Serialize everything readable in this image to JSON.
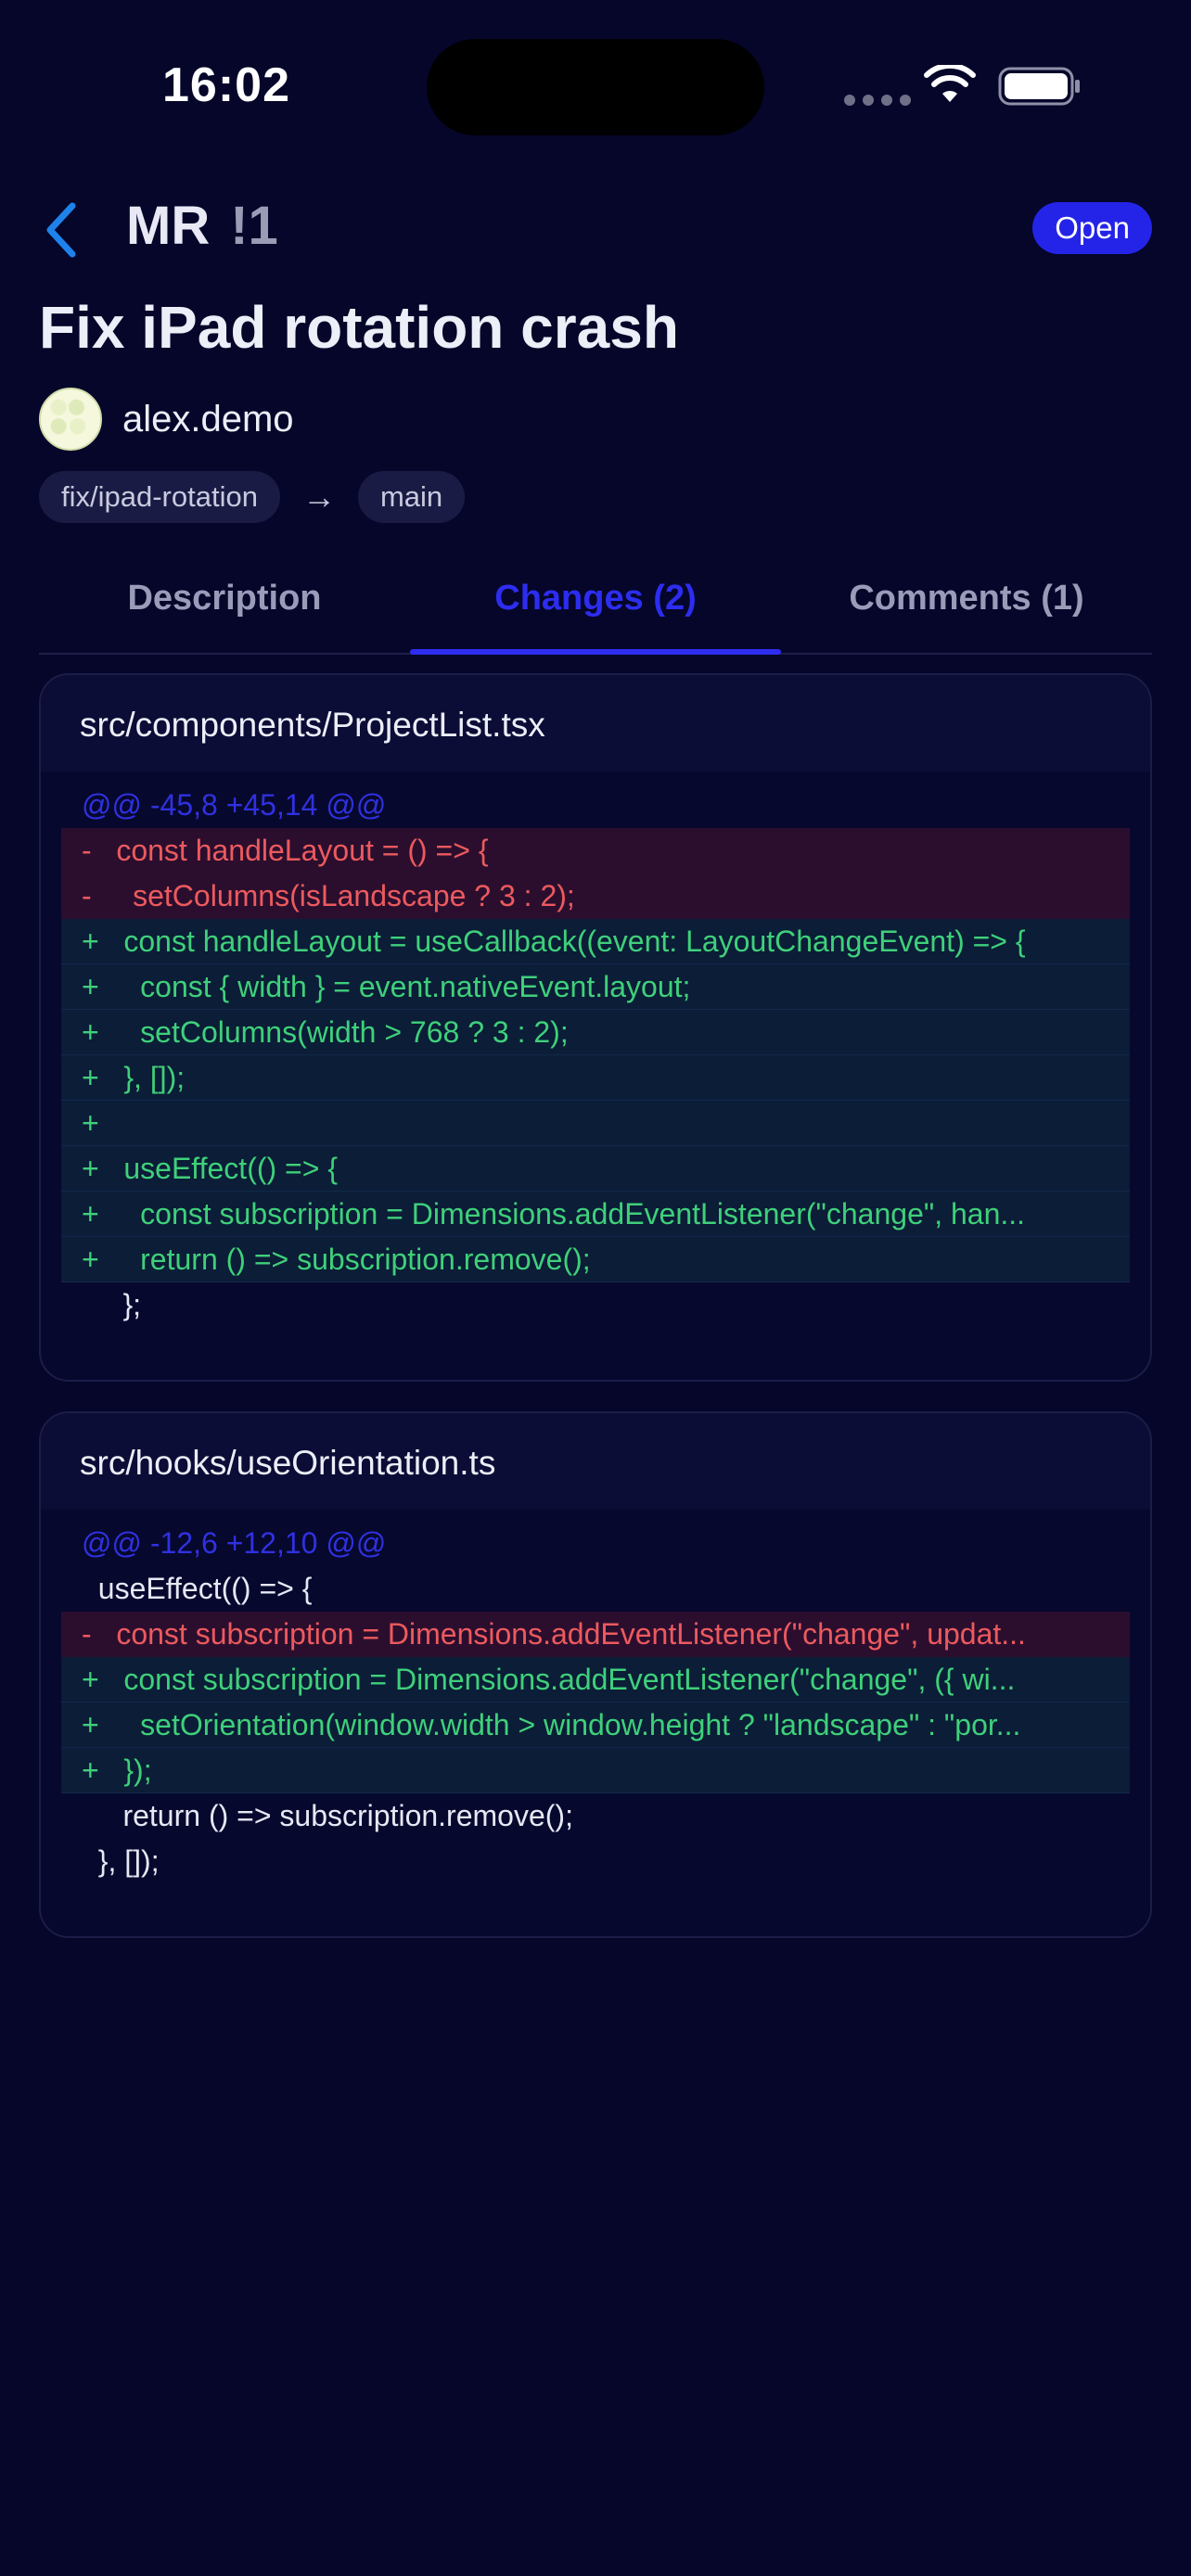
{
  "status_bar": {
    "time": "16:02"
  },
  "header": {
    "mr_prefix": "MR",
    "mr_number": "!1",
    "status": "Open"
  },
  "mr": {
    "title": "Fix iPad rotation crash",
    "author": "alex.demo",
    "source_branch": "fix/ipad-rotation",
    "arrow": "→",
    "target_branch": "main"
  },
  "tabs": [
    {
      "label": "Description",
      "active": false
    },
    {
      "label": "Changes (2)",
      "active": true
    },
    {
      "label": "Comments (1)",
      "active": false
    }
  ],
  "files": [
    {
      "path": "src/components/ProjectList.tsx",
      "lines": [
        {
          "type": "hunk",
          "text": "@@ -45,8 +45,14 @@"
        },
        {
          "type": "del",
          "text": "-   const handleLayout = () => {"
        },
        {
          "type": "del",
          "text": "-     setColumns(isLandscape ? 3 : 2);"
        },
        {
          "type": "add",
          "text": "+   const handleLayout = useCallback((event: LayoutChangeEvent) => {"
        },
        {
          "type": "add",
          "text": "+     const { width } = event.nativeEvent.layout;"
        },
        {
          "type": "add",
          "text": "+     setColumns(width > 768 ? 3 : 2);"
        },
        {
          "type": "add",
          "text": "+   }, []);"
        },
        {
          "type": "add",
          "text": "+"
        },
        {
          "type": "add",
          "text": "+   useEffect(() => {"
        },
        {
          "type": "add",
          "text": "+     const subscription = Dimensions.addEventListener(\"change\", han..."
        },
        {
          "type": "add",
          "text": "+     return () => subscription.remove();"
        },
        {
          "type": "ctx",
          "text": "     };"
        }
      ]
    },
    {
      "path": "src/hooks/useOrientation.ts",
      "lines": [
        {
          "type": "hunk",
          "text": "@@ -12,6 +12,10 @@"
        },
        {
          "type": "ctx",
          "text": "  useEffect(() => {"
        },
        {
          "type": "del",
          "text": "-   const subscription = Dimensions.addEventListener(\"change\", updat..."
        },
        {
          "type": "add",
          "text": "+   const subscription = Dimensions.addEventListener(\"change\", ({ wi..."
        },
        {
          "type": "add",
          "text": "+     setOrientation(window.width > window.height ? \"landscape\" : \"por..."
        },
        {
          "type": "add",
          "text": "+   });"
        },
        {
          "type": "ctx",
          "text": "     return () => subscription.remove();"
        },
        {
          "type": "ctx",
          "text": "  }, []);"
        }
      ]
    }
  ],
  "colors": {
    "background": "#05062a",
    "accent": "#2d2df0",
    "badge": "#2424e8",
    "addition_text": "#3fd07a",
    "deletion_text": "#ec5a5e",
    "back_chevron": "#1e82ea"
  },
  "icons": {
    "back": "chevron-left-icon",
    "wifi": "wifi-icon",
    "battery": "battery-icon"
  }
}
